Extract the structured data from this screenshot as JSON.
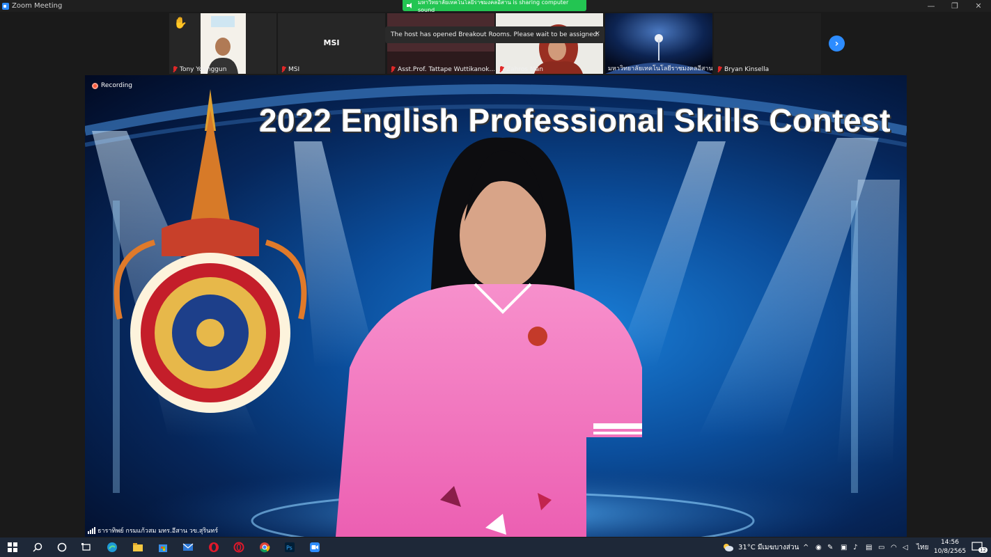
{
  "window": {
    "title": "Zoom Meeting",
    "controls": {
      "minimize": "—",
      "restore": "❐",
      "close": "✕"
    }
  },
  "share_banner": {
    "text": "มหาวิทยาลัยเทคโนโลยีราชมงคลอีสาน is sharing computer sound"
  },
  "toast": {
    "text": "The host has opened Breakout Rooms. Please wait to be assigned.",
    "close": "×"
  },
  "participants": [
    {
      "name": "Tony Younggun",
      "hand_raised": true,
      "video": true
    },
    {
      "name": "MSI",
      "display": "MSI",
      "video": false
    },
    {
      "name": "Asst.Prof. Tattape Wuttikanok...",
      "video": true
    },
    {
      "name": "Zahros Man",
      "video": true
    },
    {
      "name": "มหาวิทยาลัยเทคโนโลยีราชมงคลอีสาน",
      "video": true
    },
    {
      "name": "Bryan Kinsella",
      "video": false
    }
  ],
  "stage": {
    "recording_label": "Recording",
    "title": "2022 English Professional Skills Contest",
    "speaker_caption": "ธาราทิพย์ กรมแก้วสม มทร.อีสาน วข.สุรินทร์"
  },
  "taskbar": {
    "weather": "31°C มีเมฆบางส่วน",
    "language": "ไทย",
    "time": "14:56",
    "date": "10/8/2565",
    "notifications": "12"
  },
  "colors": {
    "zoom_blue": "#2d8cff",
    "share_green": "#23c552",
    "mic_muted": "#e02828",
    "shirt_pink": "#f07ac2"
  }
}
